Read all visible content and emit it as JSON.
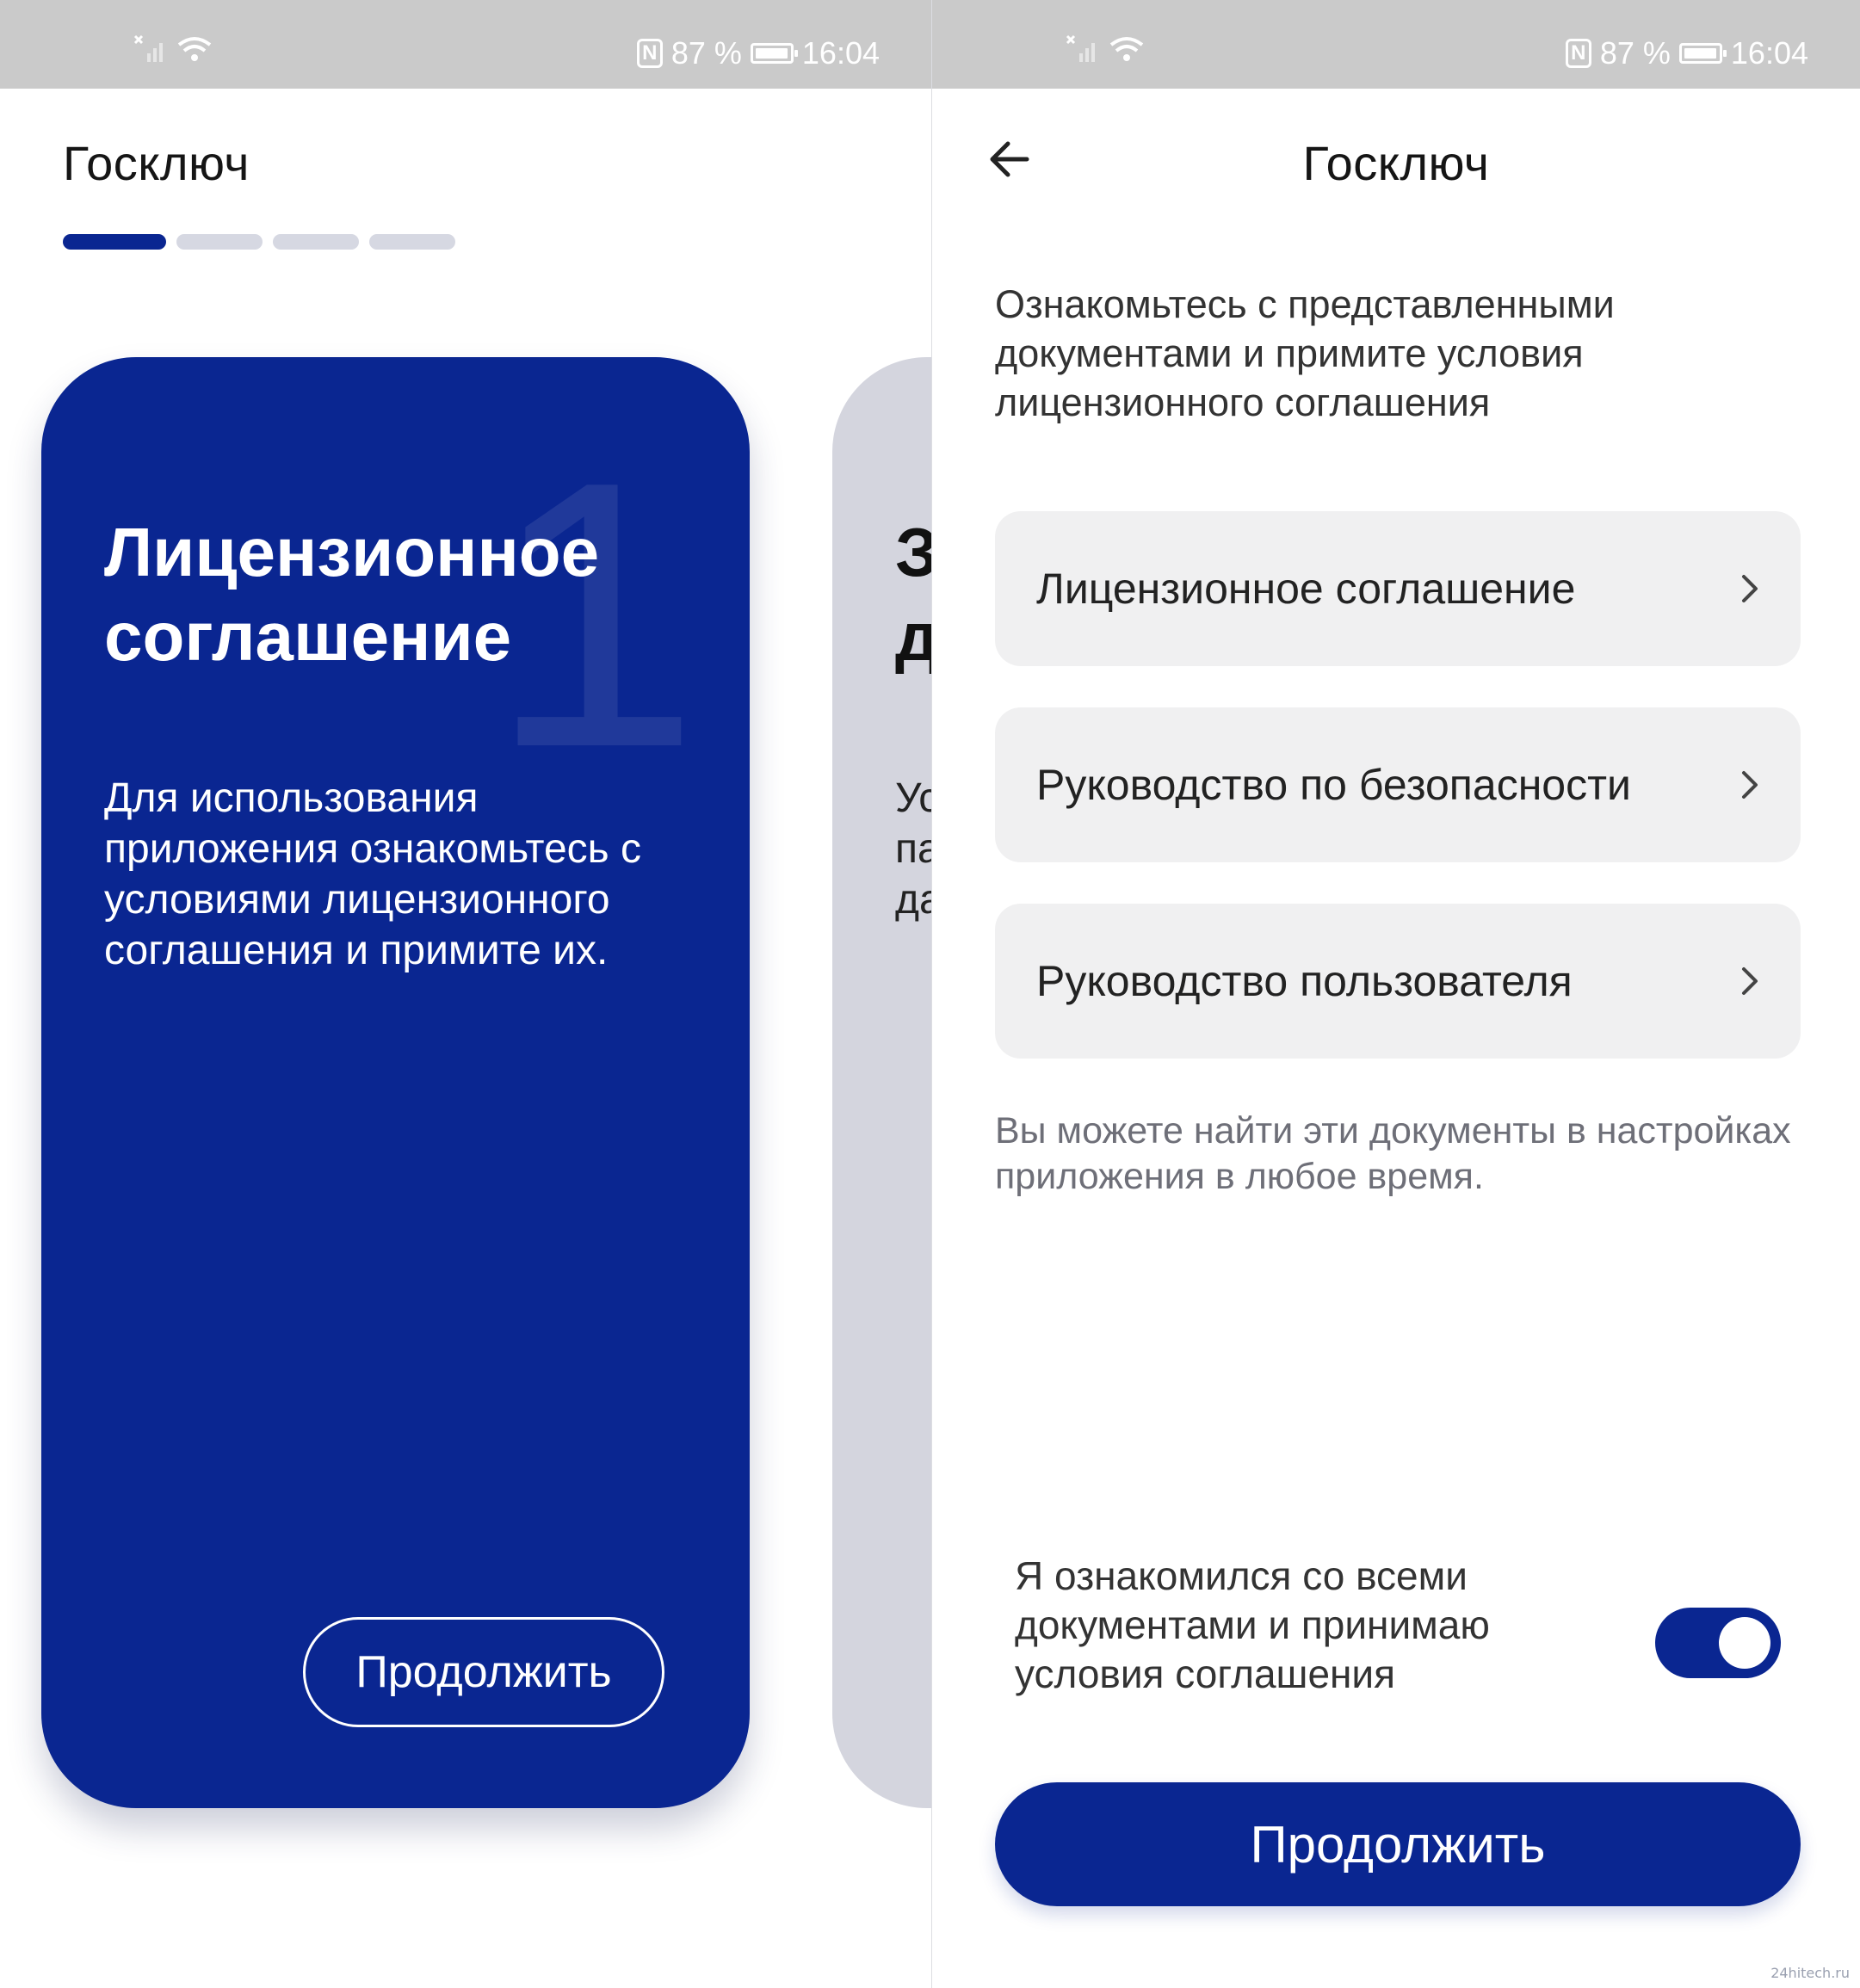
{
  "status_bar": {
    "battery_percent": "87 %",
    "time": "16:04",
    "nfc_label": "N",
    "signal_icon": "no-signal-icon",
    "wifi_icon": "wifi-icon",
    "battery_icon": "battery-icon"
  },
  "left_screen": {
    "app_title": "Госключ",
    "steps": {
      "total": 4,
      "active": 1
    },
    "card": {
      "number": "1",
      "title": "Лицензионное соглашение",
      "text": "Для использования приложения ознакомьтесь с условиями лицензионного соглашения и примите их.",
      "button_label": "Продолжить"
    },
    "next_card": {
      "title_fragment": "З\nд",
      "text_fragment": "Ус\nпа\nда"
    }
  },
  "right_screen": {
    "app_title": "Госключ",
    "intro": "Ознакомьтесь с представленными документами и примите условия лицензионного соглашения",
    "documents": [
      {
        "label": "Лицензионное соглашение"
      },
      {
        "label": "Руководство по безопасности"
      },
      {
        "label": "Руководство пользователя"
      }
    ],
    "hint": "Вы можете найти эти документы в настройках приложения в любое время.",
    "consent_text": "Я ознакомился со всеми документами и принимаю условия соглашения",
    "consent_toggle_on": true,
    "continue_label": "Продолжить"
  },
  "colors": {
    "primary": "#0a2691",
    "status_bar": "#cacaca",
    "list_item_bg": "#f0f0f1",
    "next_card_bg": "#d4d5de",
    "step_inactive": "#d6d8e2"
  },
  "watermark": "24hitech.ru"
}
